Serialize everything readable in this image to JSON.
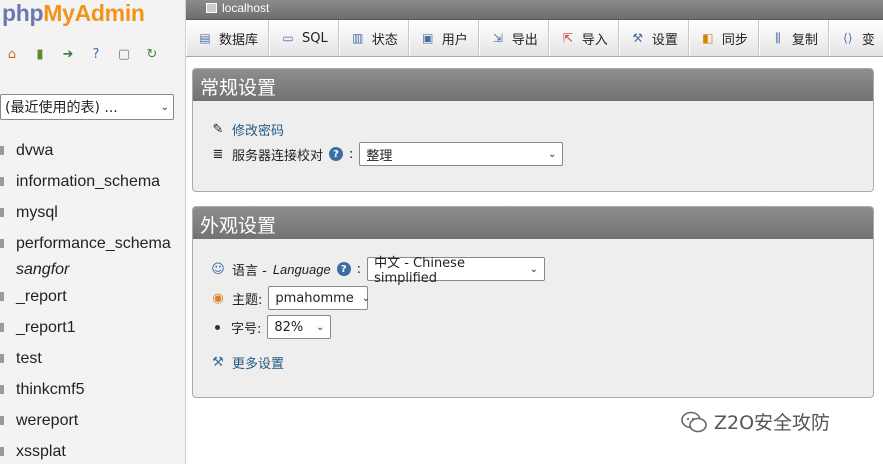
{
  "logo": {
    "php": "php",
    "my": "My",
    "admin": "Admin"
  },
  "nav": {
    "quick_icons": [
      "home-icon",
      "exit-icon",
      "query-icon",
      "help-icon",
      "docs-icon",
      "reload-icon"
    ],
    "recent_select": "(最近使用的表) ...",
    "databases": [
      "dvwa",
      "information_schema",
      "mysql",
      "performance_schema",
      "sangfor",
      "_report",
      "_report1",
      "test",
      "thinkcmf5",
      "wereport",
      "xssplat"
    ]
  },
  "topbar": {
    "server": "localhost"
  },
  "tabs": [
    {
      "label": "数据库",
      "icon": "database-icon"
    },
    {
      "label": "SQL",
      "icon": "sql-icon"
    },
    {
      "label": "状态",
      "icon": "status-icon"
    },
    {
      "label": "用户",
      "icon": "users-icon"
    },
    {
      "label": "导出",
      "icon": "export-icon"
    },
    {
      "label": "导入",
      "icon": "import-icon"
    },
    {
      "label": "设置",
      "icon": "settings-icon"
    },
    {
      "label": "同步",
      "icon": "sync-icon"
    },
    {
      "label": "复制",
      "icon": "replication-icon"
    },
    {
      "label": "变",
      "icon": "variables-icon"
    }
  ],
  "general": {
    "title": "常规设置",
    "change_password": "修改密码",
    "collation_label": "服务器连接校对",
    "collation_value": "整理"
  },
  "appearance": {
    "title": "外观设置",
    "language_label": "语言 - ",
    "language_en": "Language",
    "language_value": "中文 - Chinese simplified",
    "theme_label": "主题:",
    "theme_value": "pmahomme",
    "fontsize_label": "字号:",
    "fontsize_value": "82%",
    "more_settings": "更多设置"
  },
  "watermark": {
    "text": "Z2O安全攻防"
  }
}
